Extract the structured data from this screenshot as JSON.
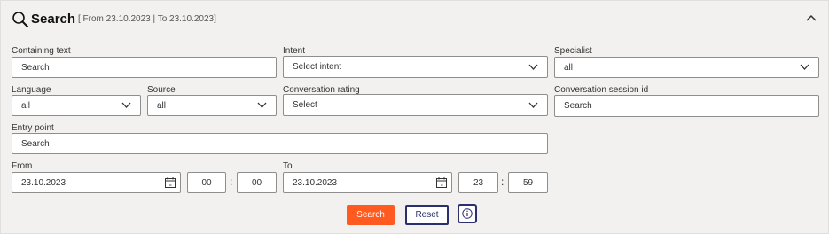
{
  "header": {
    "title": "Search",
    "range": "[ From 23.10.2023 | To 23.10.2023]",
    "icon": "search-icon",
    "collapse_icon": "chevron-up-icon"
  },
  "fields": {
    "containing_text": {
      "label": "Containing text",
      "placeholder": "Search"
    },
    "intent": {
      "label": "Intent",
      "value": "Select intent"
    },
    "specialist": {
      "label": "Specialist",
      "value": "all"
    },
    "language": {
      "label": "Language",
      "value": "all"
    },
    "source": {
      "label": "Source",
      "value": "all"
    },
    "conversation_rating": {
      "label": "Conversation rating",
      "value": "Select"
    },
    "session_id": {
      "label": "Conversation session id",
      "placeholder": "Search"
    },
    "entry_point": {
      "label": "Entry point",
      "placeholder": "Search"
    },
    "from": {
      "label": "From",
      "date": "23.10.2023",
      "hour": "00",
      "minute": "00"
    },
    "to": {
      "label": "To",
      "date": "23.10.2023",
      "hour": "23",
      "minute": "59"
    },
    "time_separator": ":"
  },
  "actions": {
    "search_label": "Search",
    "reset_label": "Reset",
    "info_icon": "info-icon"
  },
  "colors": {
    "accent": "#ff5a1f",
    "navy": "#2b2f6b",
    "background": "#f2f1f0",
    "border": "#8e8e8e"
  }
}
